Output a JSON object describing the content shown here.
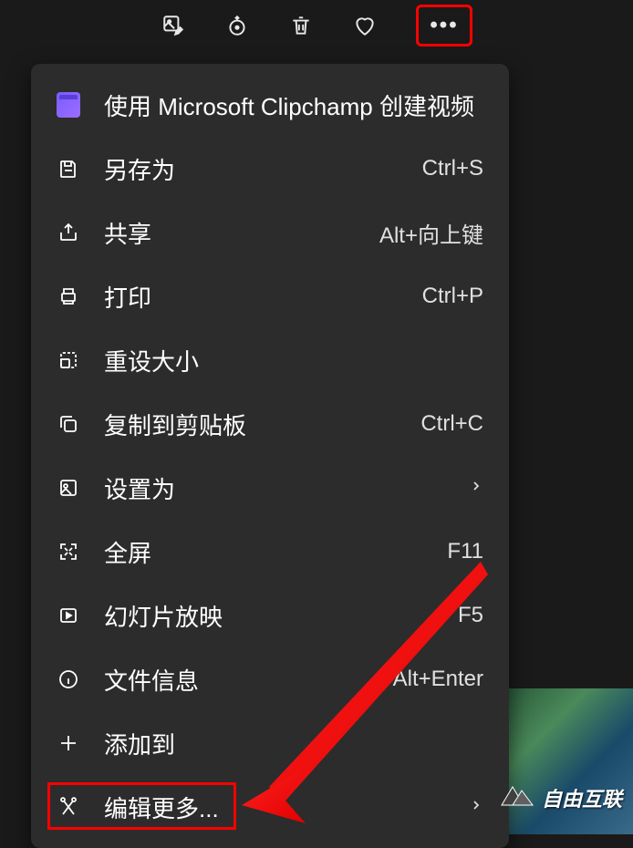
{
  "toolbar": {
    "icons": {
      "edit": "edit-image",
      "rotate": "rotate",
      "delete": "delete",
      "favorite": "favorite",
      "more": "more"
    }
  },
  "menu": {
    "items": [
      {
        "icon": "clipchamp",
        "label": "使用 Microsoft Clipchamp 创建视频",
        "shortcut": "",
        "hasSubmenu": false
      },
      {
        "icon": "save",
        "label": "另存为",
        "shortcut": "Ctrl+S",
        "hasSubmenu": false
      },
      {
        "icon": "share",
        "label": "共享",
        "shortcut": "Alt+向上键",
        "hasSubmenu": false
      },
      {
        "icon": "print",
        "label": "打印",
        "shortcut": "Ctrl+P",
        "hasSubmenu": false
      },
      {
        "icon": "resize",
        "label": "重设大小",
        "shortcut": "",
        "hasSubmenu": false
      },
      {
        "icon": "copy",
        "label": "复制到剪贴板",
        "shortcut": "Ctrl+C",
        "hasSubmenu": false
      },
      {
        "icon": "setas",
        "label": "设置为",
        "shortcut": "",
        "hasSubmenu": true
      },
      {
        "icon": "fullscreen",
        "label": "全屏",
        "shortcut": "F11",
        "hasSubmenu": false
      },
      {
        "icon": "slideshow",
        "label": "幻灯片放映",
        "shortcut": "F5",
        "hasSubmenu": false
      },
      {
        "icon": "info",
        "label": "文件信息",
        "shortcut": "Alt+Enter",
        "hasSubmenu": false
      },
      {
        "icon": "add",
        "label": "添加到",
        "shortcut": "",
        "hasSubmenu": false
      },
      {
        "icon": "editmore",
        "label": "编辑更多...",
        "shortcut": "",
        "hasSubmenu": true
      }
    ]
  },
  "watermark": {
    "text": "自由互联"
  }
}
